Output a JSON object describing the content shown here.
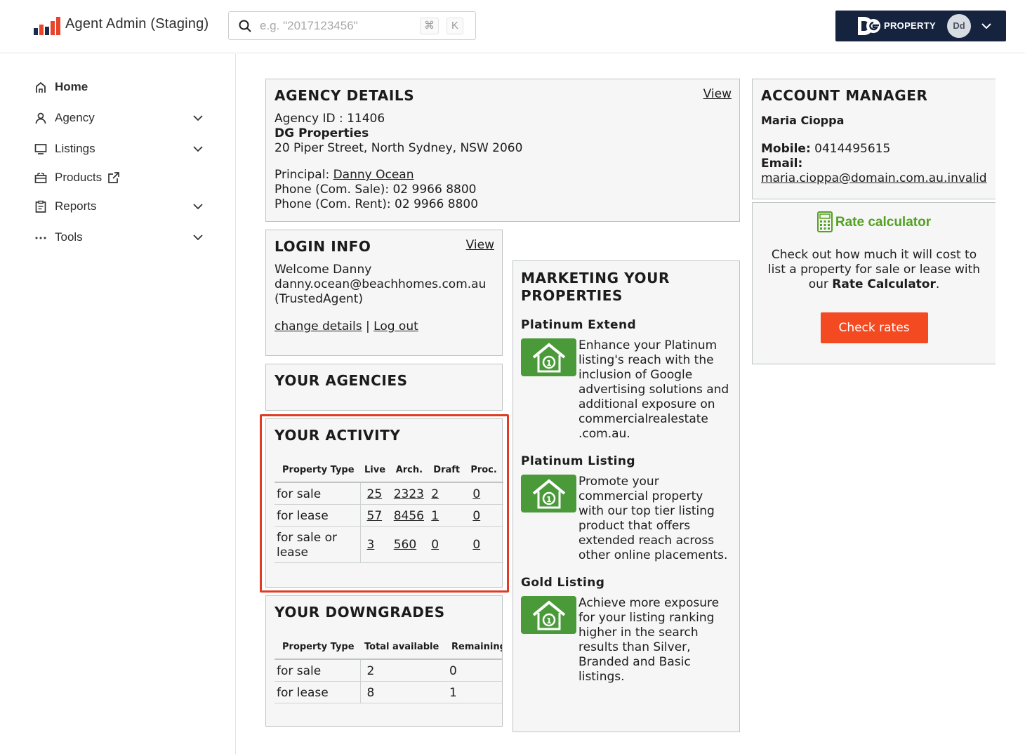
{
  "header": {
    "app_title": "Agent Admin (Staging)",
    "search_placeholder": "e.g. \"2017123456\"",
    "shortcut_cmd": "⌘",
    "shortcut_key": "K",
    "brand_name": "PROPERTY",
    "user_initials": "Dd"
  },
  "sidebar": {
    "items": [
      {
        "label": "Home",
        "icon": "home-icon",
        "active": true
      },
      {
        "label": "Agency",
        "icon": "user-icon"
      },
      {
        "label": "Listings",
        "icon": "monitor-icon"
      },
      {
        "label": "Products",
        "icon": "basket-icon"
      },
      {
        "label": "Reports",
        "icon": "clipboard-icon"
      },
      {
        "label": "Tools",
        "icon": "more-icon"
      }
    ]
  },
  "agency_details": {
    "title": "AGENCY DETAILS",
    "view": "View",
    "agency_id": "Agency ID : 11406",
    "name": "DG Properties",
    "address": "20 Piper Street, North Sydney, NSW 2060",
    "principal_label": "Principal:",
    "principal": "Danny Ocean",
    "phone_sale": "Phone (Com. Sale): 02 9966 8800",
    "phone_rent": "Phone (Com. Rent): 02 9966 8800"
  },
  "login_info": {
    "title": "LOGIN INFO",
    "view": "View",
    "welcome": "Welcome Danny",
    "email": "danny.ocean@beachhomes.com.au",
    "role": "(TrustedAgent)",
    "change_details": "change details",
    "separator": "|",
    "logout": "Log out"
  },
  "your_agencies": {
    "title": "YOUR AGENCIES"
  },
  "activity": {
    "title": "YOUR ACTIVITY",
    "headers": [
      "Property Type",
      "Live",
      "Arch.",
      "Draft",
      "Proc."
    ],
    "rows": [
      {
        "type": "for sale",
        "live": "25",
        "arch": "2323",
        "draft": "2",
        "proc": "0"
      },
      {
        "type": "for lease",
        "live": "57",
        "arch": "8456",
        "draft": "1",
        "proc": "0"
      },
      {
        "type": "for sale or lease",
        "live": "3",
        "arch": "560",
        "draft": "0",
        "proc": "0"
      }
    ]
  },
  "downgrades": {
    "title": "YOUR DOWNGRADES",
    "headers": [
      "Property Type",
      "Total available",
      "Remaining"
    ],
    "rows": [
      {
        "type": "for sale",
        "total": "2",
        "remaining": "0"
      },
      {
        "type": "for lease",
        "total": "8",
        "remaining": "1"
      }
    ]
  },
  "marketing": {
    "title": "MARKETING YOUR PROPERTIES",
    "products": [
      {
        "name": "Platinum Extend",
        "desc": "Enhance your Platinum listing's reach with the inclusion of Google advertising solutions and additional exposure on commercialrealestate .com.au."
      },
      {
        "name": "Platinum Listing",
        "desc": "Promote your commercial property with our top tier listing product that offers extended reach across other online placements."
      },
      {
        "name": "Gold Listing",
        "desc": "Achieve more exposure for your listing ranking higher in the search results than Silver, Branded and Basic listings."
      }
    ]
  },
  "account_manager": {
    "title": "ACCOUNT MANAGER",
    "name": "Maria Cioppa",
    "mobile_label": "Mobile:",
    "mobile": "0414495615",
    "email_label": "Email:",
    "email": "maria.cioppa@domain.com.au.invalid"
  },
  "rate_calculator": {
    "title": "Rate calculator",
    "text_before": "Check out how much it will cost to list a property for sale or lease with our",
    "text_bold": "Rate Calculator",
    "text_after": ".",
    "button": "Check rates"
  },
  "colors": {
    "accent": "#f44a22",
    "brand_navy": "#15233f",
    "highlight": "#e03b24",
    "green": "#54a022"
  }
}
